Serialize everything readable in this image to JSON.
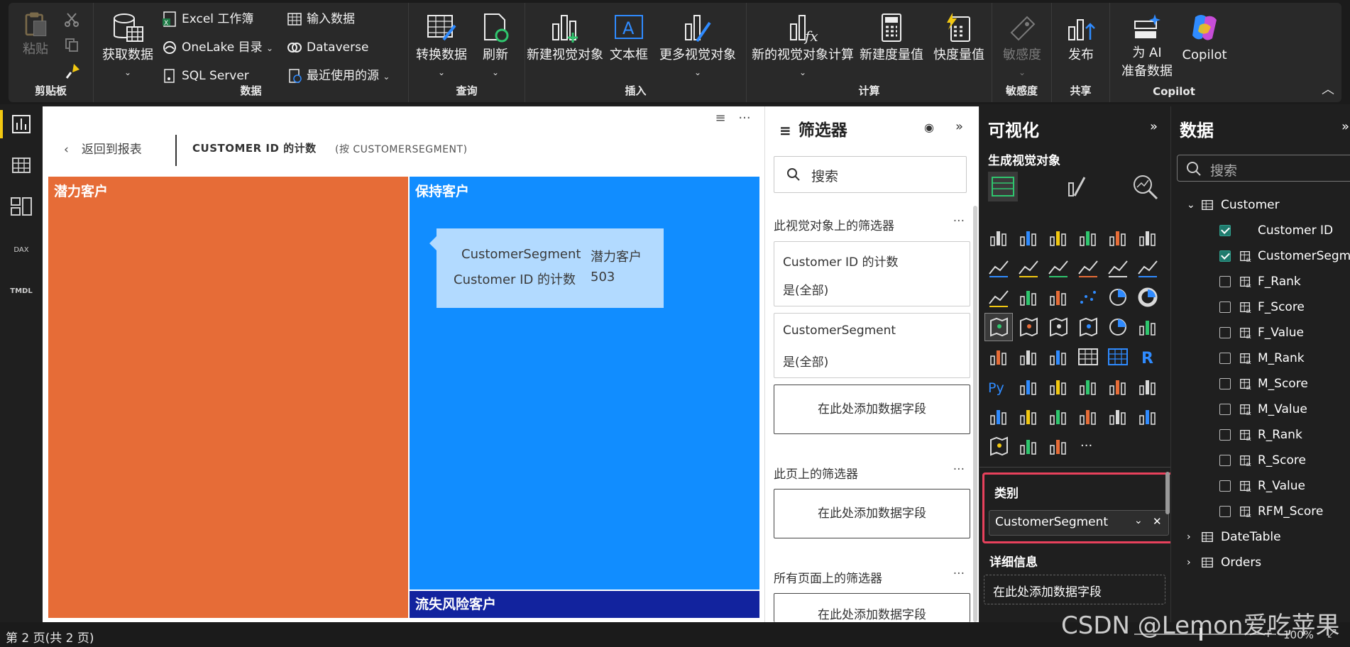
{
  "ribbon": {
    "clipboard": {
      "paste": "粘贴",
      "group": "剪贴板"
    },
    "data": {
      "get_data": "获取数据",
      "excel": "Excel 工作簿",
      "onelake": "OneLake 目录",
      "sql": "SQL Server",
      "enter_data": "输入数据",
      "dataverse": "Dataverse",
      "recent": "最近使用的源",
      "group": "数据"
    },
    "query": {
      "transform": "转换数据",
      "refresh": "刷新",
      "group": "查询"
    },
    "insert": {
      "new_visual": "新建视觉对象",
      "textbox": "文本框",
      "more_visuals": "更多视觉对象",
      "group": "插入"
    },
    "calc": {
      "visual_calc": "新的视觉对象计算",
      "new_measure": "新建度量值",
      "quick_measure": "快度量值",
      "group": "计算"
    },
    "sensitivity": {
      "label": "敏感度",
      "group": "敏感度"
    },
    "share": {
      "publish": "发布",
      "group": "共享"
    },
    "copilot": {
      "ai_prep_1": "为 AI",
      "ai_prep_2": "准备数据",
      "copilot": "Copilot",
      "group": "Copilot"
    }
  },
  "canvas": {
    "back": "返回到报表",
    "title": "CUSTOMER ID 的计数",
    "subtitle": "(按 CUSTOMERSEGMENT)",
    "tooltip": {
      "k1": "CustomerSegment",
      "v1": "潜力客户",
      "k2": "Customer ID 的计数",
      "v2": "503"
    }
  },
  "chart_data": {
    "type": "treemap",
    "categories": [
      "潜力客户",
      "保持客户",
      "流失风险客户"
    ],
    "values": [
      503,
      457,
      30
    ],
    "colors": [
      "#e66c37",
      "#118dff",
      "#12239e"
    ]
  },
  "filters": {
    "title": "筛选器",
    "search": "搜索",
    "visual_section": "此视觉对象上的筛选器",
    "card1_title": "Customer ID 的计数",
    "card1_state": "是(全部)",
    "card2_title": "CustomerSegment",
    "card2_state": "是(全部)",
    "add_field": "在此处添加数据字段",
    "page_section": "此页上的筛选器",
    "all_section": "所有页面上的筛选器",
    "more": "···"
  },
  "viz": {
    "title": "可视化",
    "subtitle": "生成视觉对象",
    "well_label": "类别",
    "well_field": "CustomerSegment",
    "detail_label": "详细信息",
    "detail_drop": "在此处添加数据字段",
    "r_label": "R",
    "py_label": "Py",
    "more": "···"
  },
  "data": {
    "title": "数据",
    "search": "搜索",
    "tables": [
      {
        "name": "Customer",
        "expanded": true
      },
      {
        "name": "DateTable",
        "expanded": false
      },
      {
        "name": "Orders",
        "expanded": false
      }
    ],
    "fields": [
      {
        "name": "Customer ID",
        "checked": true,
        "icon": "none"
      },
      {
        "name": "CustomerSegm...",
        "checked": true,
        "icon": "calc-column"
      },
      {
        "name": "F_Rank",
        "checked": false,
        "icon": "calc-column"
      },
      {
        "name": "F_Score",
        "checked": false,
        "icon": "calc-column"
      },
      {
        "name": "F_Value",
        "checked": false,
        "icon": "calc-column"
      },
      {
        "name": "M_Rank",
        "checked": false,
        "icon": "calc-column"
      },
      {
        "name": "M_Score",
        "checked": false,
        "icon": "calc-column"
      },
      {
        "name": "M_Value",
        "checked": false,
        "icon": "calc-column"
      },
      {
        "name": "R_Rank",
        "checked": false,
        "icon": "calc-column"
      },
      {
        "name": "R_Score",
        "checked": false,
        "icon": "calc-column"
      },
      {
        "name": "R_Value",
        "checked": false,
        "icon": "calc-column"
      },
      {
        "name": "RFM_Score",
        "checked": false,
        "icon": "calc-column"
      }
    ]
  },
  "status": {
    "page": "第 2 页(共 2 页)",
    "zoom": "100%"
  },
  "nav": {
    "dax": "DAX",
    "tmdl": "TMDL"
  },
  "watermark": "CSDN @Lemon爱吃苹果"
}
